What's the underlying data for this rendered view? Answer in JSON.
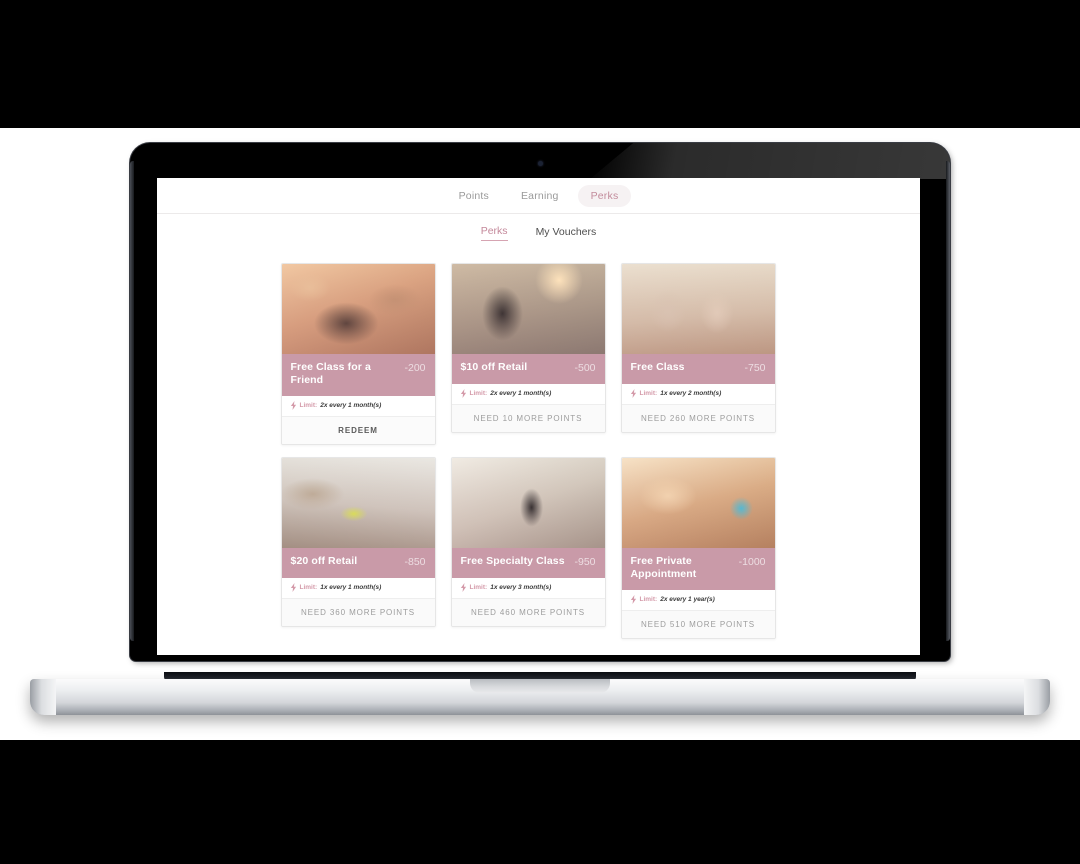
{
  "topnav": {
    "items": [
      {
        "label": "Points",
        "active": false
      },
      {
        "label": "Earning",
        "active": false
      },
      {
        "label": "Perks",
        "active": true
      }
    ]
  },
  "subtabs": {
    "items": [
      {
        "label": "Perks",
        "active": true
      },
      {
        "label": "My Vouchers",
        "active": false
      }
    ]
  },
  "labels": {
    "limit_prefix": "Limit:"
  },
  "colors": {
    "banner_pink": "#c99aa8",
    "accent_pink": "#c4899b",
    "limit_pink": "#d49aa9",
    "card_border": "#e6e6e6",
    "action_text": "#9d9d9d"
  },
  "perks": [
    {
      "title": "Free Class for a Friend",
      "cost": "-200",
      "limit": "2x every 1 month(s)",
      "action": "REDEEM",
      "redeemable": true,
      "photo": "ph-1"
    },
    {
      "title": "$10 off Retail",
      "cost": "-500",
      "limit": "2x every 1 month(s)",
      "action": "NEED 10 MORE POINTS",
      "redeemable": false,
      "photo": "ph-2"
    },
    {
      "title": "Free Class",
      "cost": "-750",
      "limit": "1x every 2 month(s)",
      "action": "NEED 260 MORE POINTS",
      "redeemable": false,
      "photo": "ph-3"
    },
    {
      "title": "$20 off Retail",
      "cost": "-850",
      "limit": "1x every 1 month(s)",
      "action": "NEED 360 MORE POINTS",
      "redeemable": false,
      "photo": "ph-4"
    },
    {
      "title": "Free Specialty Class",
      "cost": "-950",
      "limit": "1x every 3 month(s)",
      "action": "NEED 460 MORE POINTS",
      "redeemable": false,
      "photo": "ph-5"
    },
    {
      "title": "Free Private Appointment",
      "cost": "-1000",
      "limit": "2x every 1 year(s)",
      "action": "NEED 510 MORE POINTS",
      "redeemable": false,
      "photo": "ph-6"
    }
  ]
}
